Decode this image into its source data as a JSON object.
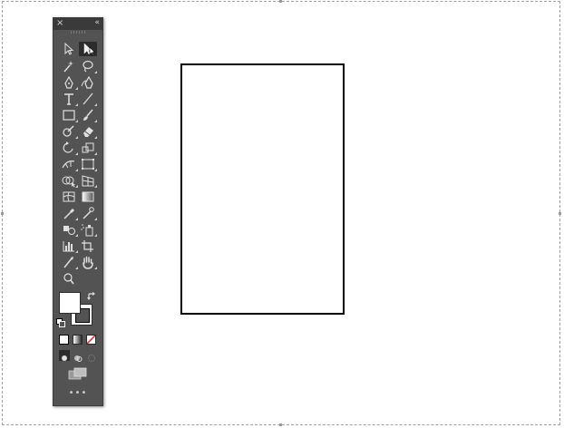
{
  "canvas": {
    "background": "#ffffff",
    "artboard_stroke": "#000000"
  },
  "toolbar": {
    "close_glyph": "×",
    "collapse_glyph": "«",
    "more_glyph": "•••",
    "background": "#535353",
    "tools": [
      {
        "name": "selection-tool",
        "icon": "arrow-outline-icon"
      },
      {
        "name": "direct-selection-tool",
        "icon": "arrow-solid-icon",
        "active": true
      },
      {
        "name": "magic-wand-tool",
        "icon": "magic-wand-icon"
      },
      {
        "name": "lasso-tool",
        "icon": "lasso-icon"
      },
      {
        "name": "pen-tool",
        "icon": "pen-icon"
      },
      {
        "name": "curvature-tool",
        "icon": "curvature-pen-icon"
      },
      {
        "name": "type-tool",
        "icon": "type-icon"
      },
      {
        "name": "line-segment-tool",
        "icon": "line-icon"
      },
      {
        "name": "rectangle-tool",
        "icon": "rectangle-icon"
      },
      {
        "name": "paintbrush-tool",
        "icon": "paintbrush-icon"
      },
      {
        "name": "shaper-tool",
        "icon": "shaper-icon"
      },
      {
        "name": "eraser-tool",
        "icon": "eraser-icon"
      },
      {
        "name": "rotate-tool",
        "icon": "rotate-icon"
      },
      {
        "name": "scale-tool",
        "icon": "scale-icon"
      },
      {
        "name": "width-tool",
        "icon": "width-icon"
      },
      {
        "name": "free-transform-tool",
        "icon": "free-transform-icon"
      },
      {
        "name": "shape-builder-tool",
        "icon": "shape-builder-icon"
      },
      {
        "name": "perspective-grid-tool",
        "icon": "perspective-grid-icon"
      },
      {
        "name": "mesh-tool",
        "icon": "mesh-icon"
      },
      {
        "name": "gradient-tool",
        "icon": "gradient-icon"
      },
      {
        "name": "eyedropper-tool",
        "icon": "eyedropper-icon"
      },
      {
        "name": "measure-tool",
        "icon": "measure-icon"
      },
      {
        "name": "blend-tool",
        "icon": "blend-icon"
      },
      {
        "name": "symbol-sprayer-tool",
        "icon": "symbol-sprayer-icon"
      },
      {
        "name": "column-graph-tool",
        "icon": "column-graph-icon"
      },
      {
        "name": "artboard-tool",
        "icon": "artboard-icon"
      },
      {
        "name": "slice-tool",
        "icon": "slice-icon"
      },
      {
        "name": "hand-tool",
        "icon": "hand-icon"
      },
      {
        "name": "zoom-tool",
        "icon": "zoom-icon"
      }
    ],
    "fill_color": "#ffffff",
    "stroke_color": "#000000"
  }
}
